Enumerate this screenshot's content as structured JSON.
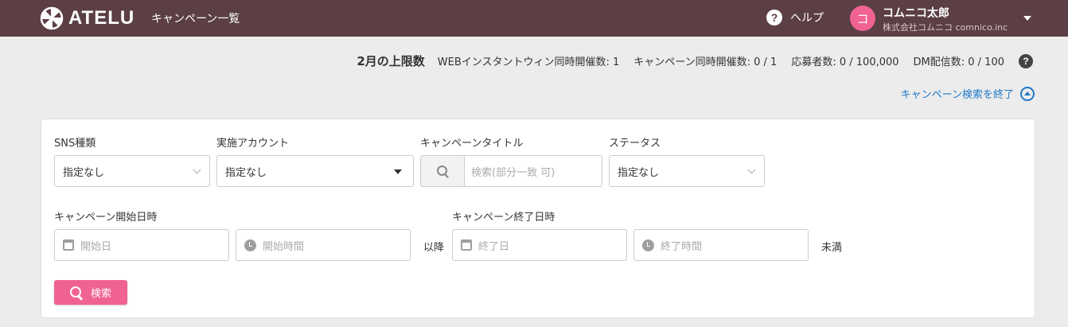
{
  "header": {
    "logo_text": "ATELU",
    "nav": "キャンペーン一覧",
    "help_label": "ヘルプ",
    "avatar_initial": "コ",
    "user_name": "コムニコ太郎",
    "user_org": "株式会社コムニコ comnico.inc"
  },
  "limits": {
    "title": "2月の上限数",
    "web_instant": "WEBインスタントウィン同時開催数: 1",
    "campaigns": "キャンペーン同時開催数: 0 / 1",
    "applicants": "応募者数: 0 / 100,000",
    "dm": "DM配信数: 0 / 100"
  },
  "close_search_label": "キャンペーン検索を終了",
  "filters": {
    "sns_label": "SNS種類",
    "sns_value": "指定なし",
    "account_label": "実施アカウント",
    "account_value": "指定なし",
    "title_label": "キャンペーンタイトル",
    "title_placeholder": "検索(部分一致 可)",
    "status_label": "ステータス",
    "status_value": "指定なし",
    "start_label": "キャンペーン開始日時",
    "start_date_placeholder": "開始日",
    "start_time_placeholder": "開始時間",
    "start_suffix": "以降",
    "end_label": "キャンペーン終了日時",
    "end_date_placeholder": "終了日",
    "end_time_placeholder": "終了時間",
    "end_suffix": "未満",
    "search_button": "検索"
  },
  "colors": {
    "header_bg": "#5b3f45",
    "accent_pink": "#f06292",
    "link_blue": "#1e78c8"
  }
}
